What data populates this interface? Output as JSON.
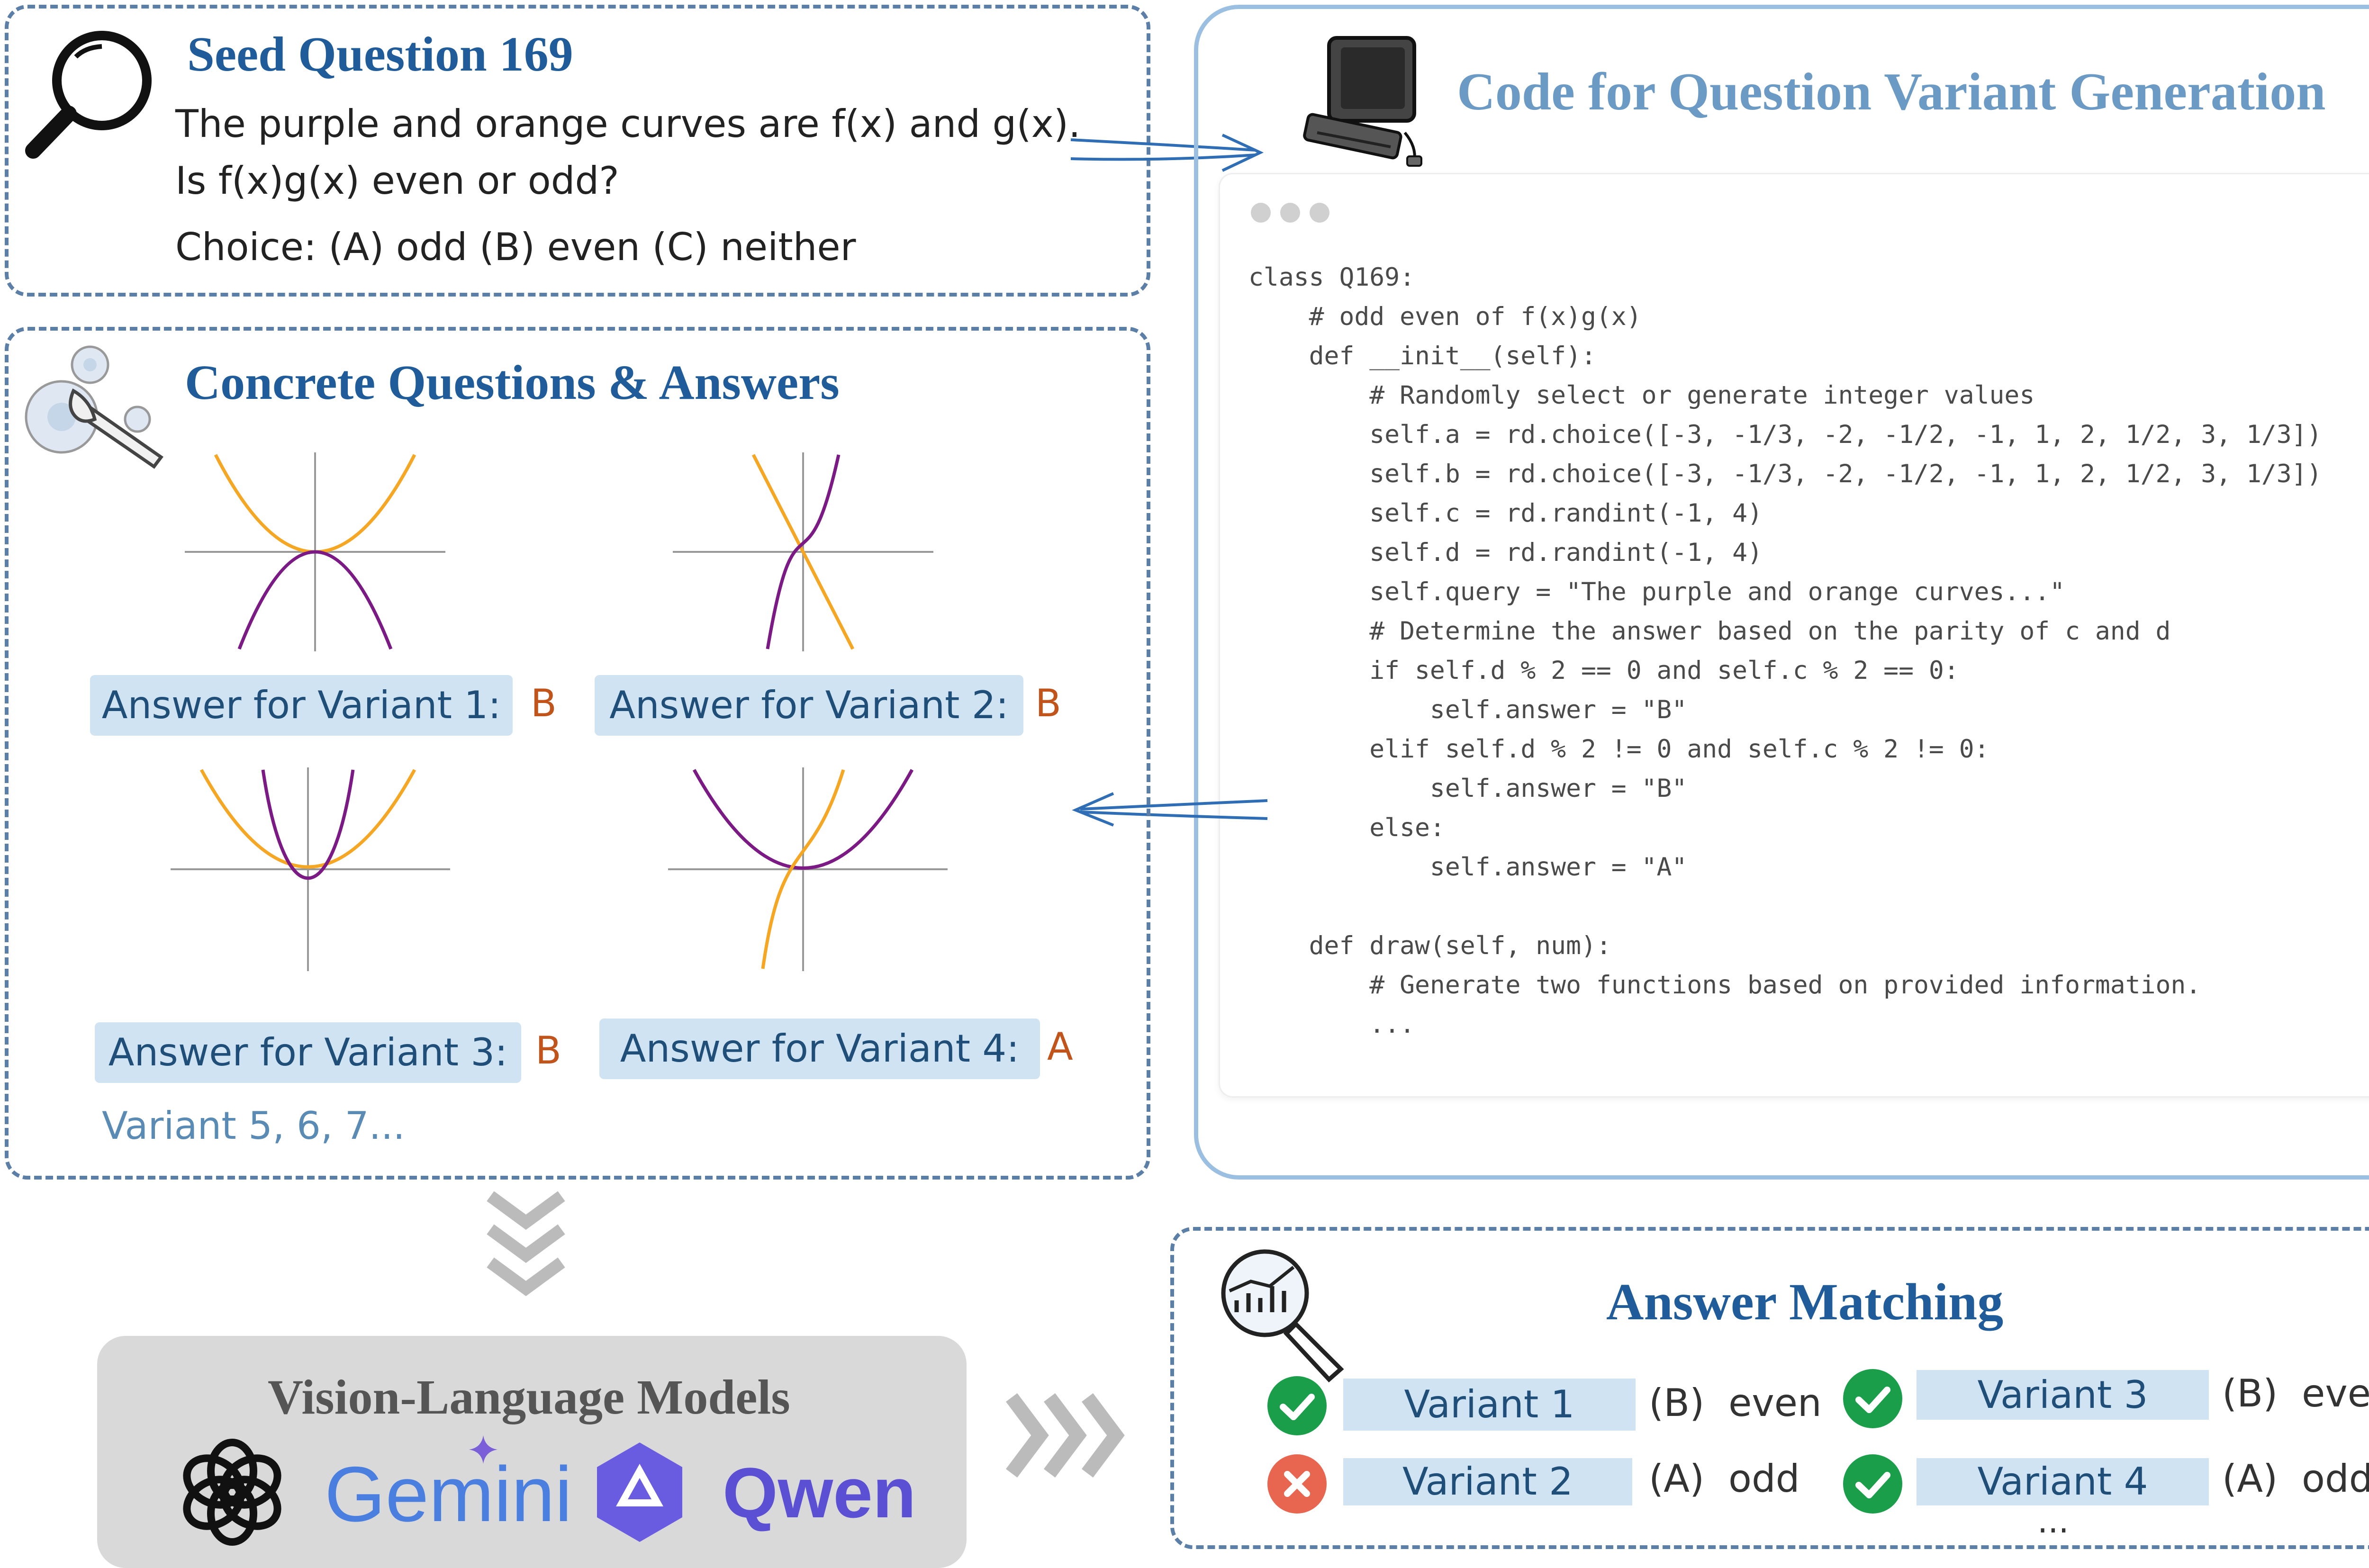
{
  "seed": {
    "title": "Seed Question 169",
    "line1": "The purple and orange curves are f(x) and g(x).",
    "line2": "Is f(x)g(x) even or odd?",
    "choice": "Choice: (A) odd   (B) even   (C) neither"
  },
  "code_panel": {
    "title": "Code for Question Variant Generation",
    "lines": [
      "class Q169:",
      "    # odd even of f(x)g(x)",
      "    def __init__(self):",
      "        # Randomly select or generate integer values",
      "        self.a = rd.choice([-3, -1/3, -2, -1/2, -1, 1, 2, 1/2, 3, 1/3])",
      "        self.b = rd.choice([-3, -1/3, -2, -1/2, -1, 1, 2, 1/2, 3, 1/3])",
      "        self.c = rd.randint(-1, 4)",
      "        self.d = rd.randint(-1, 4)",
      "        self.query = \"The purple and orange curves...\"",
      "        # Determine the answer based on the parity of c and d",
      "        if self.d % 2 == 0 and self.c % 2 == 0:",
      "            self.answer = \"B\"",
      "        elif self.d % 2 != 0 and self.c % 2 != 0:",
      "            self.answer = \"B\"",
      "        else:",
      "            self.answer = \"A\"",
      "",
      "    def draw(self, num):",
      "        # Generate two functions based on provided information.",
      "        ..."
    ]
  },
  "concrete": {
    "title": "Concrete Questions & Answers",
    "answers": [
      {
        "label": "Answer for Variant 1:",
        "value": "B"
      },
      {
        "label": "Answer for Variant 2:",
        "value": "B"
      },
      {
        "label": "Answer for Variant 3:",
        "value": "B"
      },
      {
        "label": "Answer for Variant 4:",
        "value": "A"
      }
    ],
    "more": "Variant 5, 6, 7..."
  },
  "vlm": {
    "title": "Vision-Language Models",
    "gemini": "Gemini",
    "qwen": "Qwen"
  },
  "matching": {
    "title": "Answer Matching",
    "rows": [
      {
        "variant": "Variant 1",
        "result": "(B)  even",
        "correct": true
      },
      {
        "variant": "Variant 3",
        "result": "(B)  even",
        "correct": true
      },
      {
        "variant": "Variant 2",
        "result": "(A)  odd",
        "correct": false
      },
      {
        "variant": "Variant 4",
        "result": "(A)  odd",
        "correct": true
      }
    ],
    "more": "..."
  },
  "colors": {
    "title_blue": "#1f5c99",
    "light_title": "#6b9ac4",
    "purple": "#7b1a84",
    "orange": "#f5a623",
    "correct_green": "#1a9e4a",
    "wrong_red": "#e8664f"
  },
  "icons": [
    "magnifier-icon",
    "computer-icon",
    "gears-icon",
    "chart-magnifier-icon",
    "chevron-down-icon",
    "chevron-right-icon",
    "openai-logo",
    "qwen-logo"
  ]
}
